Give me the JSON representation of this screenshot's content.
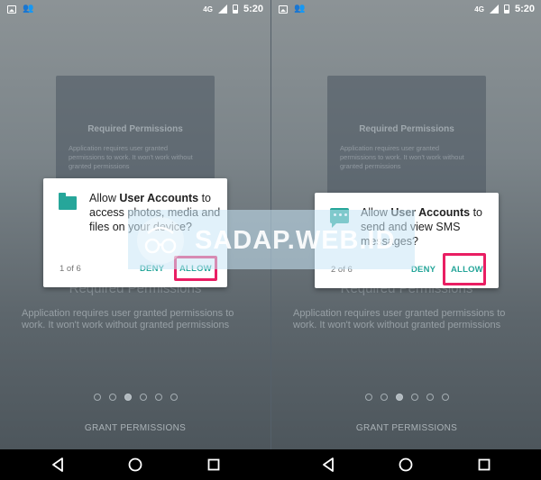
{
  "screens": [
    {
      "status": {
        "network": "4G",
        "time": "5:20"
      },
      "background": {
        "card_title": "Required Permissions",
        "card_text": "Application requires user granted permissions to work. It won't work without granted permissions",
        "heading": "Required Permissions",
        "description": "Application requires user granted permissions to work. It won't work without granted permissions",
        "grant_label": "GRANT PERMISSIONS",
        "active_dot": 3,
        "dot_count": 6
      },
      "dialog": {
        "prefix": "Allow ",
        "app_name": "User Accounts",
        "suffix": " to access photos, media and files on your device?",
        "count": "1 of 6",
        "deny_label": "DENY",
        "allow_label": "ALLOW",
        "icon": "folder-icon"
      }
    },
    {
      "status": {
        "network": "4G",
        "time": "5:20"
      },
      "background": {
        "card_title": "Required Permissions",
        "card_text": "Application requires user granted permissions to work. It won't work without granted permissions",
        "heading": "Required Permissions",
        "description": "Application requires user granted permissions to work. It won't work without granted permissions",
        "grant_label": "GRANT PERMISSIONS",
        "active_dot": 3,
        "dot_count": 6
      },
      "dialog": {
        "prefix": "Allow ",
        "app_name": "User Accounts",
        "suffix": " to send and view SMS messages?",
        "count": "2 of 6",
        "deny_label": "DENY",
        "allow_label": "ALLOW",
        "icon": "sms-icon"
      }
    }
  ],
  "watermark": {
    "text": "SADAP.WEB.ID"
  },
  "colors": {
    "accent": "#26a69a",
    "highlight": "#e91e63"
  }
}
